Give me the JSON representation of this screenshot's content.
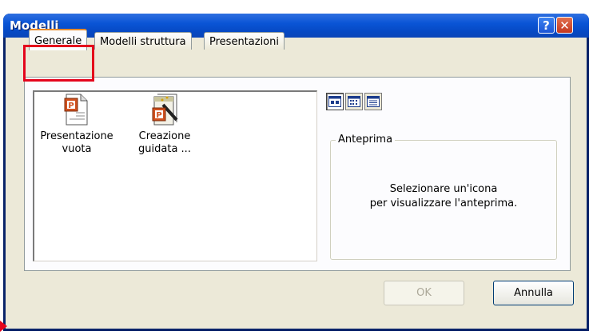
{
  "window": {
    "title": "Modelli"
  },
  "titlebar": {
    "help_glyph": "?",
    "close_glyph": "✕"
  },
  "tabs": [
    {
      "label": "Generale",
      "active": true
    },
    {
      "label": "Modelli struttura",
      "active": false
    },
    {
      "label": "Presentazioni",
      "active": false
    }
  ],
  "templates": [
    {
      "line1": "Presentazione",
      "line2": "vuota",
      "icon": "powerpoint-document-icon"
    },
    {
      "line1": "Creazione",
      "line2": "guidata ...",
      "icon": "powerpoint-wizard-icon"
    }
  ],
  "view_buttons": [
    "large-icons-view-icon",
    "list-view-icon",
    "details-view-icon"
  ],
  "preview": {
    "legend": "Anteprima",
    "message_line1": "Selezionare un'icona",
    "message_line2": "per visualizzare l'anteprima."
  },
  "buttons": {
    "ok": "OK",
    "cancel": "Annulla"
  },
  "colors": {
    "highlight": "#e4051c",
    "titlebar": "#0a55d6",
    "dialog_bg": "#ece9d8"
  }
}
